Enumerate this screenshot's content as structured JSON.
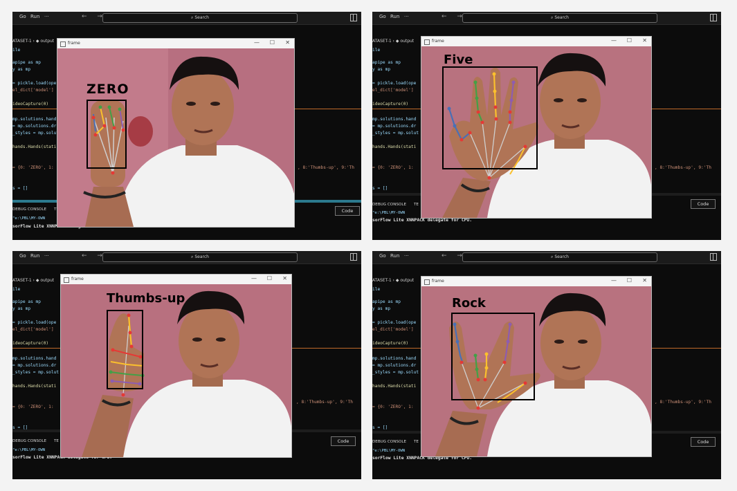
{
  "menu": {
    "go": "Go",
    "run": "Run",
    "more": "···"
  },
  "nav": {
    "arrows": "← →"
  },
  "search": {
    "label": "⌕ Search"
  },
  "breadcrumb": {
    "text": "ATASET-1 › ◆ output"
  },
  "editor": {
    "line_1": "ile",
    "line_2": "apipe as mp",
    "line_3": "y as mp",
    "line_4": "= pickle.load(ope",
    "line_5": "el_dict['model']",
    "line_6": "ideoCapture(0)",
    "line_7": "mp.solutions.hand",
    "line_8": "= mp.solutions.dr",
    "line_9": "_styles = mp.solut",
    "line_10": "hands.Hands(stati",
    "line_11": "= {0: 'ZERO', 1:",
    "line_12": "s = []",
    "right_text": ", 8:'Thumbs-up', 9:'Th"
  },
  "panel_tabs": {
    "debug": "DEBUG CONSOLE",
    "te": "TE"
  },
  "terminal": {
    "path": "\"e:\\PBL\\MY-OWN",
    "tflite": "sorFlow Lite XNNPACK delegate for CPU."
  },
  "code_button": "Code",
  "frame": {
    "title": "frame",
    "minimize": "—",
    "maximize": "☐",
    "close": "✕"
  },
  "predictions": {
    "p0": "ZERO",
    "p1": "Five",
    "p2": "Thumbs-up",
    "p3": "Rock"
  },
  "colors": {
    "wall": "#b76f80",
    "shirt": "#f2f2f2",
    "skin": "#b07456",
    "hair": "#151010",
    "bbox": "#000000",
    "landmark_red": "#e53935",
    "finger_green": "#43a047",
    "finger_yellow": "#fbc02d",
    "finger_purple": "#8e5cb0",
    "finger_blue": "#4a6fb5",
    "editor_bg": "#0c0c0c",
    "string": "#ce9178",
    "keyword": "#c586c0",
    "variable": "#9cdcfe"
  }
}
